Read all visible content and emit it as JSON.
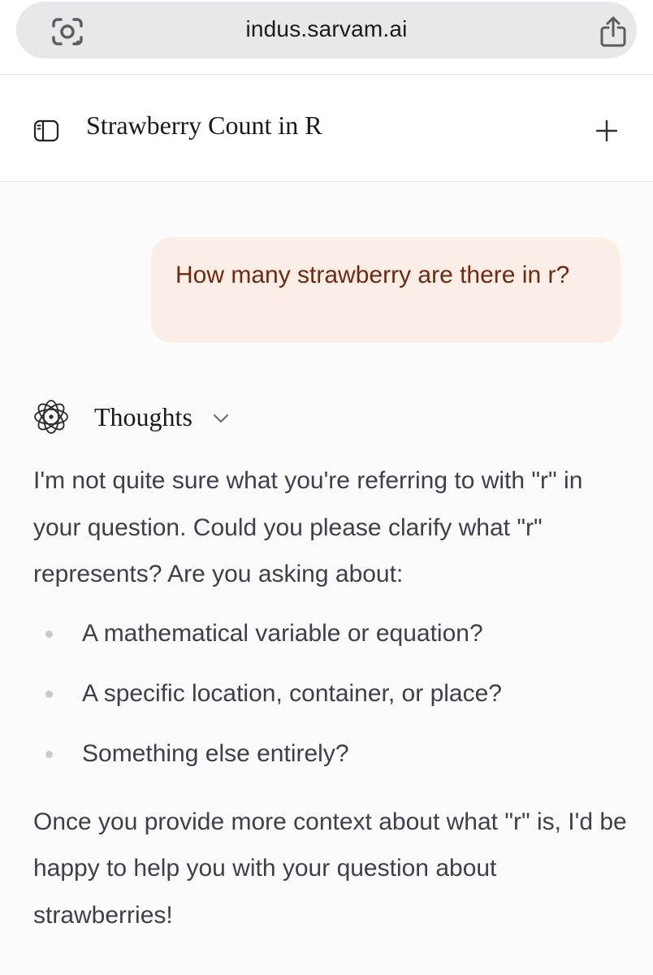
{
  "browser": {
    "url": "indus.sarvam.ai",
    "icons": {
      "lens": "camera-lens-icon",
      "share": "share-icon"
    }
  },
  "header": {
    "title": "Strawberry Count in R",
    "icons": {
      "sidebar": "sidebar-toggle-icon",
      "new_chat": "plus-icon"
    }
  },
  "conversation": {
    "user_message": "How many strawberry are there in r?",
    "thoughts": {
      "label": "Thoughts",
      "icons": {
        "thoughts": "orbit-icon",
        "expand": "chevron-down-icon"
      }
    },
    "response": {
      "intro": "I'm not quite sure what you're referring to with \"r\" in your question. Could you please clarify what \"r\" represents? Are you asking about:",
      "options": [
        "A mathematical variable or equation?",
        "A specific location, container, or place?",
        "Something else entirely?"
      ],
      "closing": "Once you provide more context about what \"r\" is, I'd be happy to help you with your question about strawberries!"
    }
  },
  "colors": {
    "url_pill": "#e7e8ea",
    "user_bubble": "#faeee6",
    "user_text": "#6e2a10",
    "response_text": "#3d3f4a",
    "chat_background": "#fbfbfc"
  }
}
